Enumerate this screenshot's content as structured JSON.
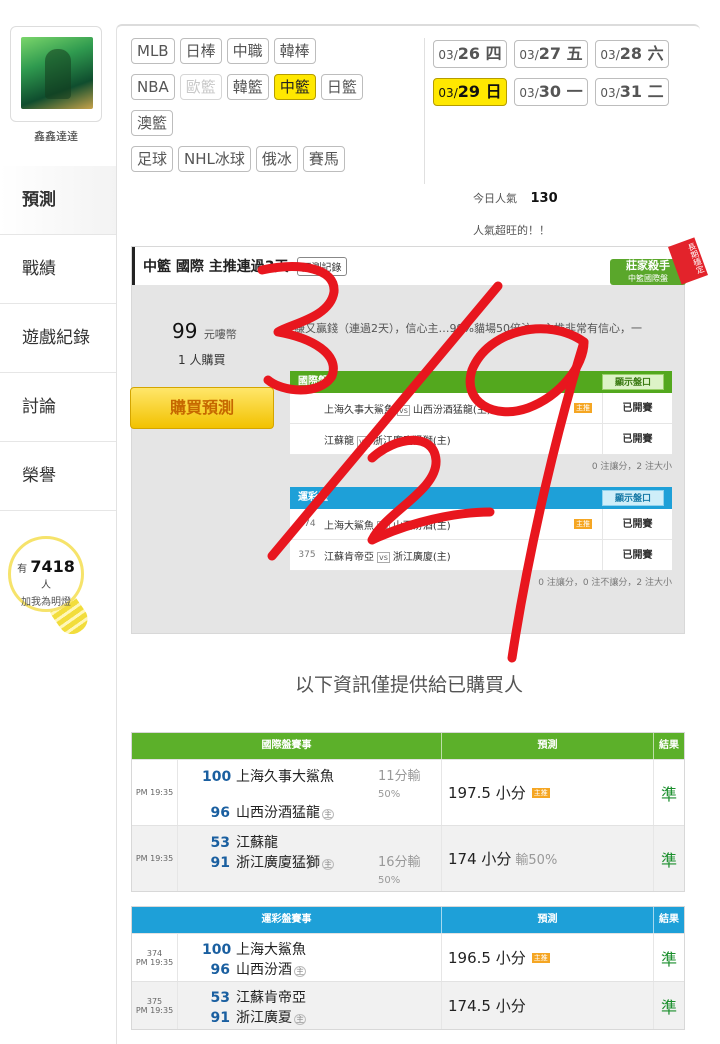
{
  "user": {
    "name": "鑫鑫達達"
  },
  "nav": [
    {
      "label": "預測",
      "active": true
    },
    {
      "label": "戰績"
    },
    {
      "label": "遊戲紀錄"
    },
    {
      "label": "討論"
    },
    {
      "label": "榮譽"
    }
  ],
  "bulb": {
    "prefix": "有",
    "count": "7418",
    "suffix": "人",
    "text": "加我為明燈"
  },
  "leagues": [
    [
      "MLB",
      "日棒",
      "中職",
      "韓棒"
    ],
    [
      "NBA",
      "歐籃",
      "韓籃",
      "中籃",
      "日籃"
    ],
    [
      "澳籃"
    ],
    [
      "足球",
      "NHL冰球",
      "俄冰",
      "賽馬"
    ]
  ],
  "dates": [
    {
      "m": "03/",
      "d": "26 四"
    },
    {
      "m": "03/",
      "d": "27 五"
    },
    {
      "m": "03/",
      "d": "28 六"
    },
    {
      "m": "03/",
      "d": "29 日"
    },
    {
      "m": "03/",
      "d": "30 一"
    },
    {
      "m": "03/",
      "d": "31 二"
    }
  ],
  "popularity": {
    "label": "今日人氣",
    "value": "130",
    "note": "人氣超旺的！！"
  },
  "card": {
    "title": "中籃 國際 主推連過3天",
    "record_btn": "預測記錄",
    "badge_title": "莊家殺手",
    "badge_sub": "中籃國際盤",
    "badge_ribbon": "長期穩定",
    "price": "99",
    "price_unit": "元嘍幣",
    "buyers": "1 人購買",
    "buy_btn": "購買預測",
    "desc": "賺又贏錢（連過2天），信心主…99%貓場50倍注，主推非常有信心，一",
    "intl_header": "國際盤",
    "show_btn": "顯示盤口",
    "intl_rows": [
      {
        "num": "",
        "away": "上海久事大鯊魚",
        "home": "山西汾酒猛龍(主)",
        "tag": "主推",
        "result": "已開賽"
      },
      {
        "num": "",
        "away": "江蘇龍",
        "home": "浙江廣廈猛獅(主)",
        "tag": "",
        "result": "已開賽"
      }
    ],
    "intl_note": "0 注讓分，2 注大小",
    "lottery_header": "運彩盤",
    "lottery_rows": [
      {
        "num": "374",
        "away": "上海大鯊魚",
        "home": "山西汾酒(主)",
        "tag": "主推",
        "result": "已開賽"
      },
      {
        "num": "375",
        "away": "江蘇肯帝亞",
        "home": "浙江廣廈(主)",
        "tag": "",
        "result": "已開賽"
      }
    ],
    "lottery_note": "0 注讓分，0 注不讓分，2 注大小"
  },
  "info_note": "以下資訊僅提供給已購買人",
  "results_intl": {
    "headers": [
      "國際盤賽事",
      "預測",
      "結果"
    ],
    "rows": [
      {
        "num": "",
        "time": "PM 19:35",
        "s1": "100",
        "t1": "上海久事大鯊魚",
        "s2": "96",
        "t2": "山西汾酒猛龍",
        "m1": "11分輸",
        "m2": "50%",
        "pick": "197.5 小分",
        "pick_extra": "",
        "tag": "主推",
        "result": "準"
      },
      {
        "num": "",
        "time": "PM 19:35",
        "s1": "53",
        "t1": "江蘇龍",
        "s2": "91",
        "t2": "浙江廣廈猛獅",
        "m1": "16分輸",
        "m2": "50%",
        "pick": "174 小分",
        "pick_extra": "輸50%",
        "tag": "",
        "result": "準"
      }
    ]
  },
  "results_lottery": {
    "headers": [
      "運彩盤賽事",
      "預測",
      "結果"
    ],
    "rows": [
      {
        "num": "374",
        "time": "PM 19:35",
        "s1": "100",
        "t1": "上海大鯊魚",
        "s2": "96",
        "t2": "山西汾酒",
        "pick": "196.5 小分",
        "tag": "主推",
        "result": "準"
      },
      {
        "num": "375",
        "time": "PM 19:35",
        "s1": "53",
        "t1": "江蘇肯帝亞",
        "s2": "91",
        "t2": "浙江廣夏",
        "pick": "174.5 小分",
        "tag": "",
        "result": "準"
      }
    ]
  },
  "home_mark": "主",
  "vs_mark": "vs",
  "handwriting": {
    "text": "3/29",
    "color": "#e8161e"
  },
  "colors": {
    "active": "#ffe800",
    "green": "#5cb02a",
    "blue": "#1ea0d8",
    "accurate": "#1b8f2d"
  }
}
